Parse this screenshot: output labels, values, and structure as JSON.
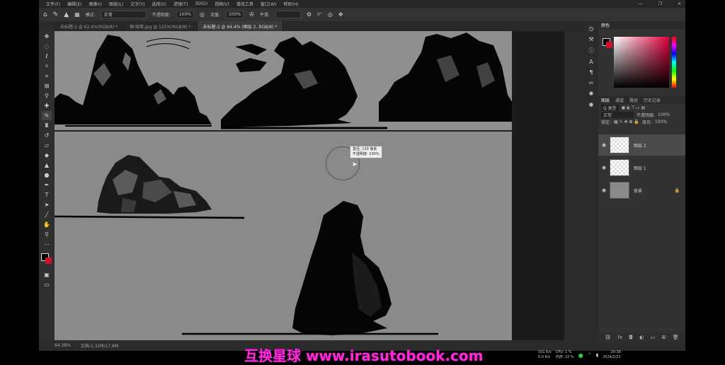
{
  "menubar": {
    "items": [
      "文件(F)",
      "编辑(E)",
      "图像(I)",
      "图层(L)",
      "文字(Y)",
      "选择(S)",
      "滤镜(T)",
      "3D(D)",
      "视图(V)",
      "增效工具",
      "窗口(W)",
      "帮助(H)"
    ]
  },
  "options": {
    "mode_label": "模式:",
    "mode_value": "正常",
    "opacity_label": "不透明度:",
    "opacity_value": "100%",
    "flow_label": "流量:",
    "flow_value": "100%",
    "smooth_label": "平滑:",
    "angle_value": "0°"
  },
  "tabs": [
    {
      "label": "未标题-1 @ 62.4%(RGB/8) *"
    },
    {
      "label": "图·田草.jpg @ 125%(RGB/8) *"
    },
    {
      "label": "未标题-2 @ 64.4% (图层 2, RGB/8) *"
    }
  ],
  "tools": [
    "move-icon",
    "marquee-icon",
    "lasso-icon",
    "magic-wand-icon",
    "crop-icon",
    "frame-icon",
    "eyedropper-icon",
    "healing-icon",
    "brush-icon",
    "stamp-icon",
    "history-brush-icon",
    "eraser-icon",
    "bucket-icon",
    "gradient-icon",
    "dodge-icon",
    "pen-icon",
    "type-icon",
    "path-select-icon",
    "shape-icon",
    "hand-icon",
    "zoom-icon",
    "more-icon"
  ],
  "tooltip": {
    "line1": "直径: 130 像素",
    "line2": "不透明度: 100%"
  },
  "status": {
    "zoom": "64.38%",
    "doc": "文档:1.32M/17.6M"
  },
  "panel": {
    "color_tabs": [
      "颜色"
    ],
    "layer_tabs": [
      "图层",
      "通道",
      "路径",
      "历史记录"
    ],
    "filter_label": "Q 类型",
    "blend_mode": "正常",
    "opacity_label": "不透明度:",
    "opacity_value": "100%",
    "lock_label": "锁定:",
    "fill_label": "填充:",
    "fill_value": "100%",
    "layers": [
      {
        "name": "图层 2",
        "selected": true
      },
      {
        "name": "图层 1",
        "selected": false
      },
      {
        "name": "背景",
        "selected": false
      }
    ]
  },
  "taskbar": {
    "net_up": "101 K/s",
    "net_down": "0.0 K/s",
    "cpu": "CPU: 1 %",
    "mem": "内存: 22 %",
    "time": "20:38",
    "date": "2024/2/21"
  },
  "watermark": "互换星球 www.irasutobook.com",
  "colors": {
    "canvas": "#8a8a8a",
    "fg": "#000000",
    "bg": "#d0102a",
    "watermark": "#ff2bd6"
  }
}
